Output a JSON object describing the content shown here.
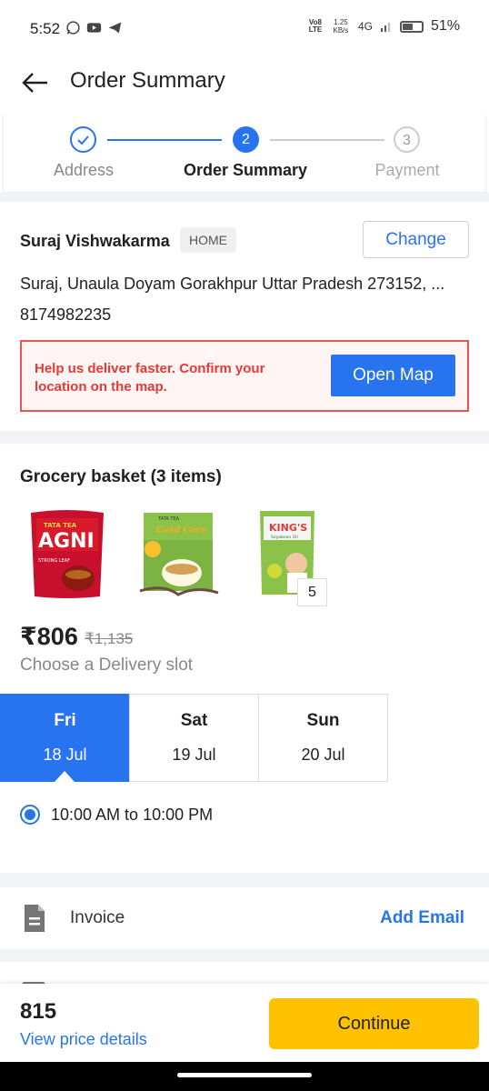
{
  "status_bar": {
    "time": "5:52",
    "volte": "Vo8 LTE",
    "speed": "1.25 KB/s",
    "network": "4G",
    "battery": "51%"
  },
  "header": {
    "title": "Order Summary"
  },
  "stepper": {
    "steps": [
      {
        "number": "1",
        "label": "Address",
        "state": "done"
      },
      {
        "number": "2",
        "label": "Order Summary",
        "state": "active"
      },
      {
        "number": "3",
        "label": "Payment",
        "state": "pending"
      }
    ]
  },
  "address": {
    "name": "Suraj Vishwakarma",
    "tag": "HOME",
    "change_label": "Change",
    "line": "Suraj, Unaula Doyam Gorakhpur Uttar Pradesh 273152, ...",
    "phone": "8174982235",
    "map_prompt": "Help us deliver faster. Confirm your location on the map.",
    "map_button": "Open Map"
  },
  "grocery": {
    "title": "Grocery basket (3 items)",
    "products": [
      {
        "name": "Tata Tea Agni",
        "brand_text": "AGNI",
        "maker": "TATA TEA",
        "variant": "STRONG LEAF"
      },
      {
        "name": "Tata Tea Gold Care",
        "brand_text": "Gold Care",
        "maker": "TATA TEA"
      },
      {
        "name": "King's Soyabean Oil",
        "brand_text": "KING'S",
        "variant": "Soyabean Oil"
      }
    ],
    "extra_count": "5",
    "price": "₹806",
    "mrp": "₹1,135",
    "slot_title": "Choose a Delivery slot",
    "days": [
      {
        "day": "Fri",
        "date": "18 Jul",
        "selected": true
      },
      {
        "day": "Sat",
        "date": "19 Jul",
        "selected": false
      },
      {
        "day": "Sun",
        "date": "20 Jul",
        "selected": false
      }
    ],
    "slot_time": "10:00 AM to 10:00 PM"
  },
  "invoice": {
    "label": "Invoice",
    "action": "Add Email"
  },
  "footer": {
    "total": "815",
    "view_details": "View price details",
    "continue_label": "Continue"
  },
  "colors": {
    "accent": "#2874f0",
    "cta": "#ffc200",
    "error": "#e53935"
  }
}
